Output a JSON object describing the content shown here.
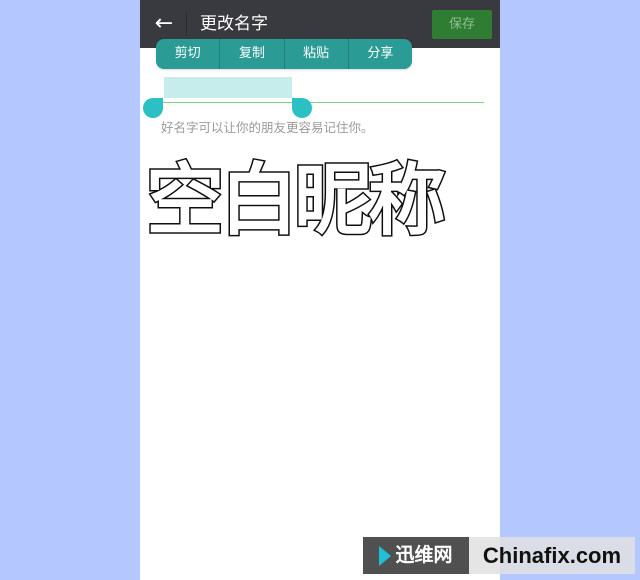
{
  "header": {
    "back_icon": "arrow-left-icon",
    "title": "更改名字",
    "save_label": "保存"
  },
  "context_menu": {
    "items": [
      {
        "label": "剪切"
      },
      {
        "label": "复制"
      },
      {
        "label": "粘贴"
      },
      {
        "label": "分享"
      }
    ]
  },
  "name_field": {
    "hint": "好名字可以让你的朋友更容易记住你。"
  },
  "overlay": {
    "caption": "空白昵称"
  },
  "watermark": {
    "left_text": "迅维网",
    "right_text": "Chinafix.com"
  },
  "colors": {
    "page_background": "#b4c8ff",
    "topbar": "#393a3f",
    "save_button": "#2e7d32",
    "context_menu": "#2b9b96",
    "selection_handle": "#2bc0c3",
    "selection_highlight": "#c7ecec",
    "input_underline": "#7cd17f"
  }
}
